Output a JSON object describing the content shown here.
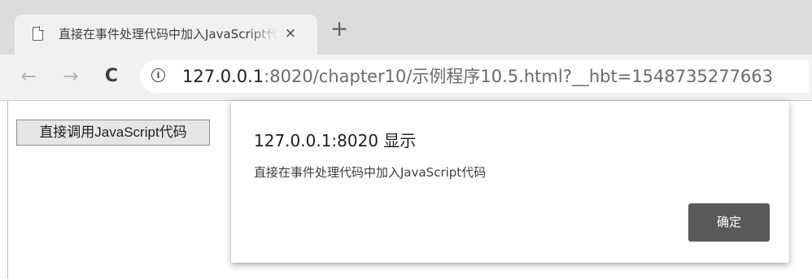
{
  "tab": {
    "title": "直接在事件处理代码中加入JavaScript代码",
    "close_symbol": "×",
    "new_tab_symbol": "+"
  },
  "toolbar": {
    "back_symbol": "←",
    "forward_symbol": "→",
    "reload_symbol": "C",
    "info_symbol": "i",
    "url_host": "127.0.0.1",
    "url_rest": ":8020/chapter10/示例程序10.5.html?__hbt=1548735277663"
  },
  "page": {
    "button_label": "直接调用JavaScript代码"
  },
  "dialog": {
    "title": "127.0.0.1:8020 显示",
    "message": "直接在事件处理代码中加入JavaScript代码",
    "ok_label": "确定"
  },
  "icons": {
    "page": "page-icon",
    "close": "close-icon",
    "new_tab": "plus-icon",
    "back": "arrow-left-icon",
    "forward": "arrow-right-icon",
    "reload": "reload-icon",
    "info": "info-icon"
  },
  "colors": {
    "dialog_button": "#5a5a5a",
    "tabstrip": "#dcdcdc",
    "toolbar": "#f1f1f1"
  }
}
